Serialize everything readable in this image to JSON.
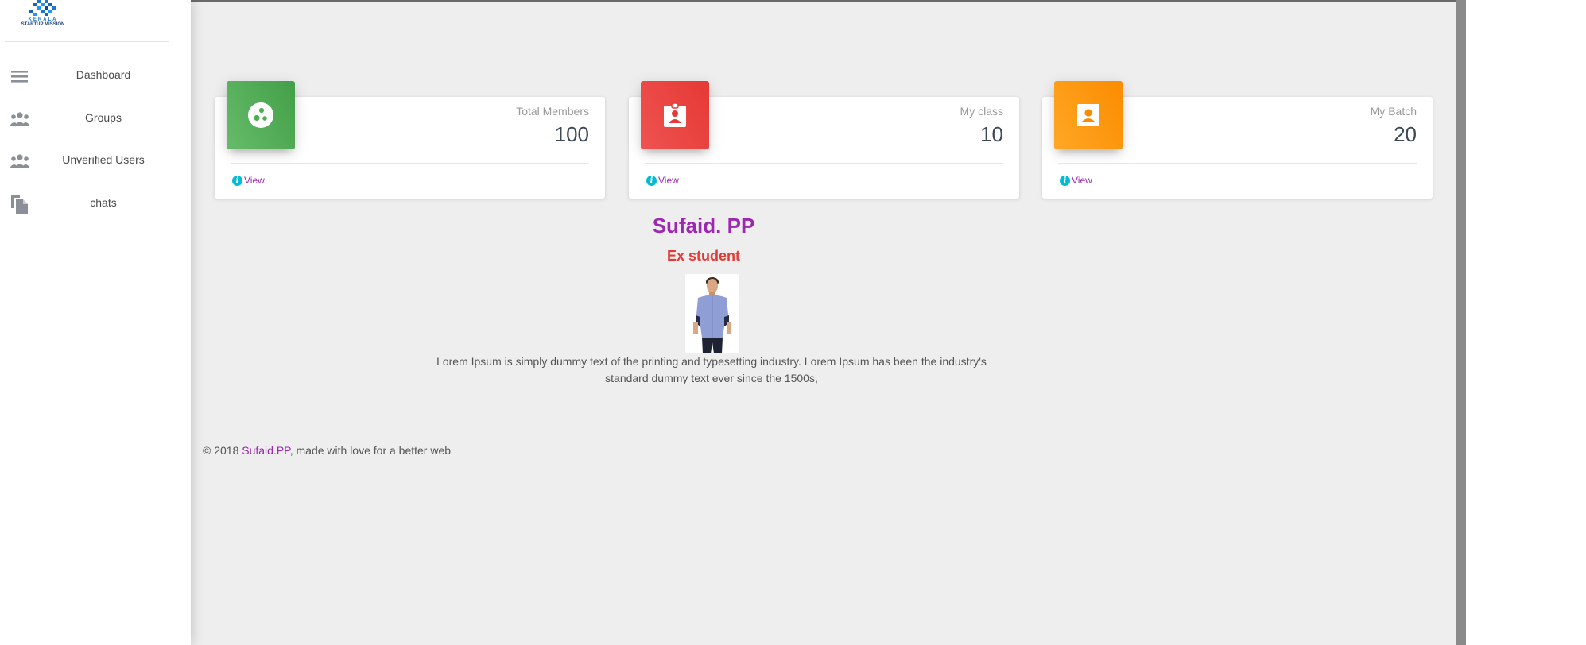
{
  "brand": {
    "logo_text_top": "KERALA",
    "logo_text_bottom": "STARTUP MISSION"
  },
  "sidebar": {
    "items": [
      {
        "label": "Dashboard",
        "icon": "menu-icon"
      },
      {
        "label": "Groups",
        "icon": "group-icon"
      },
      {
        "label": "Unverified Users",
        "icon": "group-icon"
      },
      {
        "label": "chats",
        "icon": "copy-icon"
      }
    ]
  },
  "stats": [
    {
      "category": "Total Members",
      "value": "100",
      "link": "View",
      "icon": "bubble-chart-icon",
      "color": "#4caf50"
    },
    {
      "category": "My class",
      "value": "10",
      "link": "View",
      "icon": "assignment-ind-icon",
      "color": "#e53935"
    },
    {
      "category": "My Batch",
      "value": "20",
      "link": "View",
      "icon": "account-box-icon",
      "color": "#ff9800"
    }
  ],
  "info_glyph": "i",
  "profile": {
    "name": "Sufaid. PP",
    "role": "Ex student",
    "bio": "Lorem Ipsum is simply dummy text of the printing and typesetting industry. Lorem Ipsum has been the industry's standard dummy text ever since the 1500s,"
  },
  "footer": {
    "prefix": "© 2018 ",
    "author": "Sufaid.PP",
    "suffix": ", made with love for a better web"
  },
  "colors": {
    "accent": "#9c27b0",
    "danger": "#e53935",
    "info": "#00bcd4",
    "background": "#eeeeee"
  }
}
